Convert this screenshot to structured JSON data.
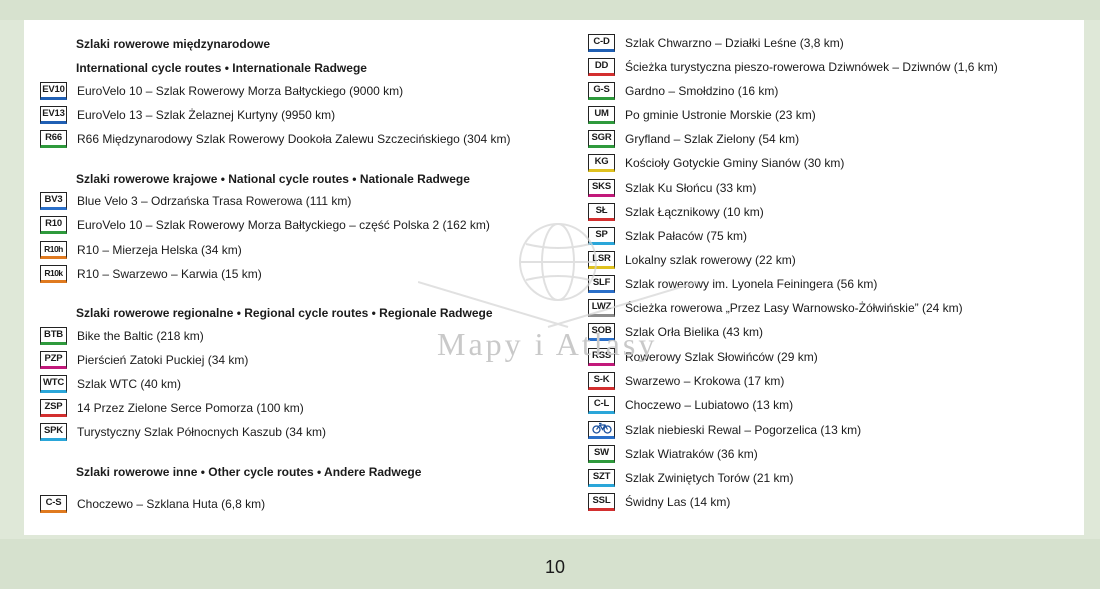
{
  "left_column": {
    "sections": [
      {
        "title_line1": "Szlaki rowerowe międzynarodowe",
        "title_line2": "International cycle routes • Internationale Radwege",
        "items": [
          {
            "code": "EV10",
            "label": "EuroVelo 10 – Szlak Rowerowy Morza Bałtyckiego (9000 km)",
            "color": "#1f5fb4"
          },
          {
            "code": "EV13",
            "label": "EuroVelo 13 – Szlak Żelaznej Kurtyny (9950 km)",
            "color": "#1f5fb4"
          },
          {
            "code": "R66",
            "label": "R66 Międzynarodowy Szlak Rowerowy Dookoła Zalewu Szczecińskiego (304 km)",
            "color": "#2e9a3c"
          }
        ]
      },
      {
        "title_line1": "Szlaki rowerowe krajowe • National cycle routes • Nationale Radwege",
        "items": [
          {
            "code": "BV3",
            "label": "Blue Velo 3 – Odrzańska Trasa Rowerowa (111 km)",
            "color": "#2a6fc9"
          },
          {
            "code": "R10",
            "label": "EuroVelo 10 – Szlak Rowerowy Morza Bałtyckiego – część Polska 2 (162 km)",
            "color": "#2e9a3c"
          },
          {
            "code": "R10h",
            "label": "R10 – Mierzeja Helska (34 km)",
            "color": "#e07a1f"
          },
          {
            "code": "R10k",
            "label": "R10 – Swarzewo – Karwia (15 km)",
            "color": "#e07a1f"
          }
        ]
      },
      {
        "title_line1": "Szlaki rowerowe regionalne • Regional cycle routes • Regionale Radwege",
        "items": [
          {
            "code": "BTB",
            "label": "Bike the Baltic (218 km)",
            "color": "#2e9a3c"
          },
          {
            "code": "PZP",
            "label": "Pierścień Zatoki Puckiej (34 km)",
            "color": "#c2187a"
          },
          {
            "code": "WTC",
            "label": "Szlak WTC (40 km)",
            "color": "#2aa6d9"
          },
          {
            "code": "ZSP",
            "label": "14 Przez Zielone Serce Pomorza (100 km)",
            "color": "#d32f2f"
          },
          {
            "code": "SPK",
            "label": "Turystyczny Szlak Północnych Kaszub (34 km)",
            "color": "#2aa6d9"
          }
        ]
      },
      {
        "title_line1": "Szlaki rowerowe inne • Other cycle routes • Andere Radwege",
        "items": [
          {
            "code": "C-S",
            "label": "Choczewo – Szklana Huta (6,8 km)",
            "color": "#e07a1f"
          }
        ]
      }
    ]
  },
  "right_column": {
    "items": [
      {
        "code": "C-D",
        "label": "Szlak Chwarzno – Działki Leśne (3,8 km)",
        "color": "#1f5fb4"
      },
      {
        "code": "DD",
        "label": "Ścieżka turystyczna pieszo-rowerowa Dziwnówek – Dziwnów (1,6 km)",
        "color": "#d32f2f"
      },
      {
        "code": "G-S",
        "label": "Gardno – Smołdzino (16 km)",
        "color": "#2e9a3c"
      },
      {
        "code": "UM",
        "label": "Po gminie Ustronie Morskie (23 km)",
        "color": "#2e9a3c"
      },
      {
        "code": "SGR",
        "label": "Gryfland – Szlak Zielony (54 km)",
        "color": "#2e9a3c"
      },
      {
        "code": "KG",
        "label": "Kościoły Gotyckie Gminy Sianów (30 km)",
        "color": "#e0c21f"
      },
      {
        "code": "SKS",
        "label": "Szlak Ku Słońcu (33 km)",
        "color": "#c2187a"
      },
      {
        "code": "SŁ",
        "label": "Szlak Łącznikowy (10 km)",
        "color": "#d32f2f"
      },
      {
        "code": "SP",
        "label": "Szlak Pałaców (75 km)",
        "color": "#2aa6d9"
      },
      {
        "code": "LSR",
        "label": "Lokalny szlak rowerowy (22 km)",
        "color": "#e0c21f"
      },
      {
        "code": "SLF",
        "label": "Szlak rowerowy im. Lyonela Feiningera (56 km)",
        "color": "#2a6fc9"
      },
      {
        "code": "LWZ",
        "label": "Ścieżka rowerowa „Przez Lasy Warnowsko-Żółwińskie” (24 km)",
        "color": "#8c8c8c"
      },
      {
        "code": "SOB",
        "label": "Szlak Orła Bielika (43 km)",
        "color": "#2a6fc9"
      },
      {
        "code": "RSS",
        "label": "Rowerowy Szlak Słowińców (29 km)",
        "color": "#c2187a"
      },
      {
        "code": "S-K",
        "label": "Swarzewo – Krokowa (17 km)",
        "color": "#d32f2f"
      },
      {
        "code": "C-L",
        "label": "Choczewo – Lubiatowo (13 km)",
        "color": "#2aa6d9"
      },
      {
        "code": "bike-icon",
        "label": "Szlak niebieski Rewal – Pogorzelica (13 km)",
        "color": "#2a6fc9"
      },
      {
        "code": "SW",
        "label": "Szlak Wiatraków (36 km)",
        "color": "#2e9a3c"
      },
      {
        "code": "SZT",
        "label": "Szlak Zwiniętych Torów (21 km)",
        "color": "#2aa6d9"
      },
      {
        "code": "SSL",
        "label": "Świdny Las (14 km)",
        "color": "#d32f2f"
      }
    ]
  },
  "watermark": {
    "text": "Mapy i Atlasy"
  },
  "page_number": "10"
}
